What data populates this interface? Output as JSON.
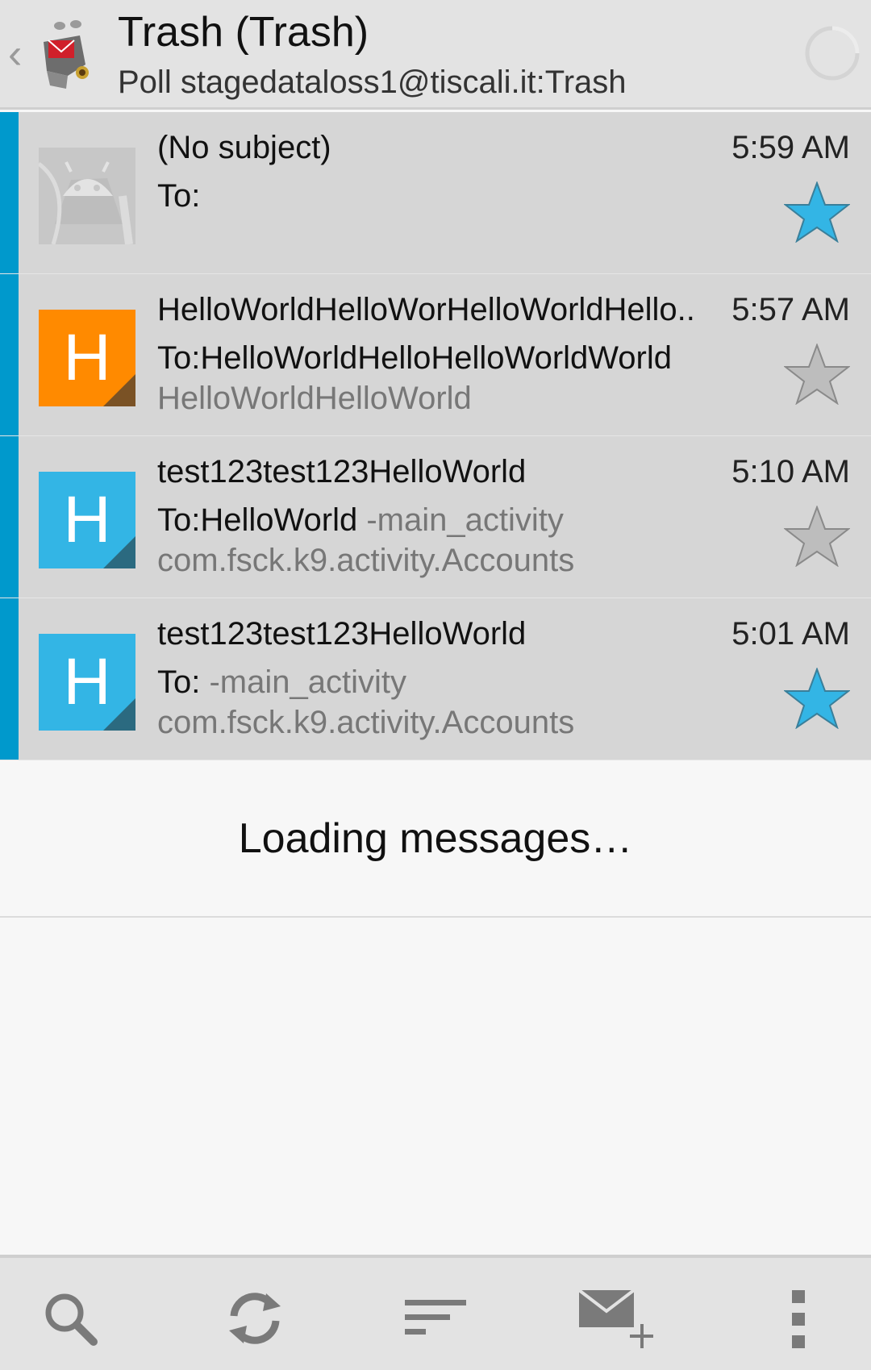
{
  "action_bar": {
    "title": "Trash (Trash)",
    "subtitle": "Poll stagedataloss1@tiscali.it:Trash"
  },
  "messages": [
    {
      "subject": "(No subject)",
      "time": "5:59 AM",
      "to": "To:",
      "to_preview": "",
      "preview": "",
      "starred": true,
      "avatar": "android-placeholder"
    },
    {
      "subject": "HelloWorldHelloWorHelloWorldHello..",
      "time": "5:57 AM",
      "to": "To:HelloWorldHelloHelloWorldWorld",
      "to_preview": "",
      "preview": "HelloWorldHelloWorld",
      "starred": false,
      "avatar_letter": "H",
      "avatar_color": "#ff8a00",
      "avatar_corner": "#7a5225"
    },
    {
      "subject": "test123test123HelloWorld",
      "time": "5:10 AM",
      "to": "To:HelloWorld",
      "to_preview": " -main_activity",
      "preview": "com.fsck.k9.activity.Accounts",
      "starred": false,
      "avatar_letter": "H",
      "avatar_color": "#33b5e5",
      "avatar_corner": "#2b6a80"
    },
    {
      "subject": "test123test123HelloWorld",
      "time": "5:01 AM",
      "to": "To:",
      "to_preview": " -main_activity",
      "preview": "com.fsck.k9.activity.Accounts",
      "starred": true,
      "avatar_letter": "H",
      "avatar_color": "#33b5e5",
      "avatar_corner": "#2b6a80"
    }
  ],
  "loading": {
    "text": "Loading messages…"
  },
  "toolbar": {
    "icons": [
      "search-icon",
      "refresh-icon",
      "sort-icon",
      "compose-icon",
      "overflow-menu-icon"
    ]
  },
  "colors": {
    "accent": "#0099cc",
    "star_on": "#33b5e5",
    "star_off": "#bdbdbd"
  }
}
